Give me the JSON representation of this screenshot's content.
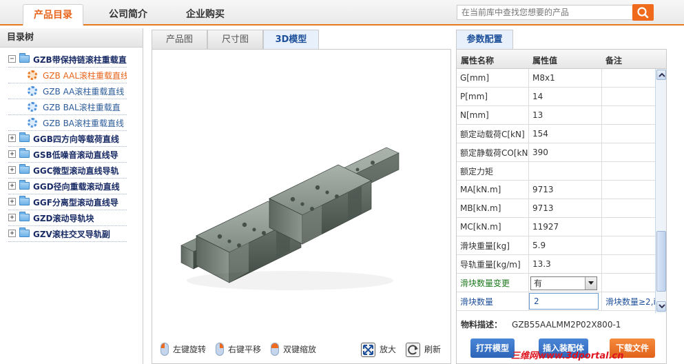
{
  "topnav": {
    "tabs": [
      "产品目录",
      "公司简介",
      "企业购买"
    ],
    "active": 0,
    "search_placeholder": "在当前库中查找您想要的产品"
  },
  "tree": {
    "title": "目录树",
    "items": [
      {
        "label": "GZB带保持链滚柱重载直",
        "level": 0,
        "toggle": "−"
      },
      {
        "label": "GZB AAL滚柱重载直线",
        "level": 1,
        "selected": true
      },
      {
        "label": "GZB AA滚柱重载直线",
        "level": 1
      },
      {
        "label": "GZB BAL滚柱重载直",
        "level": 1
      },
      {
        "label": "GZB BA滚柱重载直线",
        "level": 1
      },
      {
        "label": "GGB四方向等载荷直线",
        "level": 0,
        "toggle": "+"
      },
      {
        "label": "GSB低噪音滚动直线导",
        "level": 0,
        "toggle": "+"
      },
      {
        "label": "GGC微型滚动直线导轨",
        "level": 0,
        "toggle": "+"
      },
      {
        "label": "GGD径向重载滚动直线",
        "level": 0,
        "toggle": "+"
      },
      {
        "label": "GGF分离型滚动直线导",
        "level": 0,
        "toggle": "+"
      },
      {
        "label": "GZD滚动导轨块",
        "level": 0,
        "toggle": "+"
      },
      {
        "label": "GZV滚柱交叉导轨副",
        "level": 0,
        "toggle": "+"
      }
    ]
  },
  "viewer": {
    "tabs": [
      "产品图",
      "尺寸图",
      "3D模型"
    ],
    "active": 2,
    "controls": {
      "rotate": "左键旋转",
      "pan": "右键平移",
      "zoom": "双键缩放",
      "enlarge": "放大",
      "refresh": "刷新"
    }
  },
  "params": {
    "tab": "参数配置",
    "headers": [
      "属性名称",
      "属性值",
      "备注"
    ],
    "rows": [
      {
        "name": "G[mm]",
        "value": "M8x1",
        "note": ""
      },
      {
        "name": "P[mm]",
        "value": "14",
        "note": ""
      },
      {
        "name": "N[mm]",
        "value": "13",
        "note": ""
      },
      {
        "name": "额定动载荷C[kN]",
        "value": "154",
        "note": ""
      },
      {
        "name": "额定静载荷CO[kN]",
        "value": "390",
        "note": ""
      },
      {
        "name": "额定力矩",
        "value": "",
        "note": ""
      },
      {
        "name": "MA[kN.m]",
        "value": "9713",
        "note": ""
      },
      {
        "name": "MB[kN.m]",
        "value": "9713",
        "note": ""
      },
      {
        "name": "MC[kN.m]",
        "value": "11927",
        "note": ""
      },
      {
        "name": "滑块重量[kg]",
        "value": "5.9",
        "note": ""
      },
      {
        "name": "导轨重量[kg/m]",
        "value": "13.3",
        "note": ""
      },
      {
        "name": "滑块数量变更",
        "value": "有",
        "note": ""
      },
      {
        "name": "滑块数量",
        "value": "2",
        "note": "滑块数量≥2,i"
      }
    ],
    "material_label": "物料描述：",
    "material_value": "GZB55AALMM2P02X800-1",
    "buttons": [
      "打开模型",
      "插入装配体",
      "下载文件"
    ]
  },
  "watermark": "三维网www.3dportal.cn",
  "colors": {
    "accent": "#ef6a1d",
    "blue": "#1d4f9a"
  }
}
